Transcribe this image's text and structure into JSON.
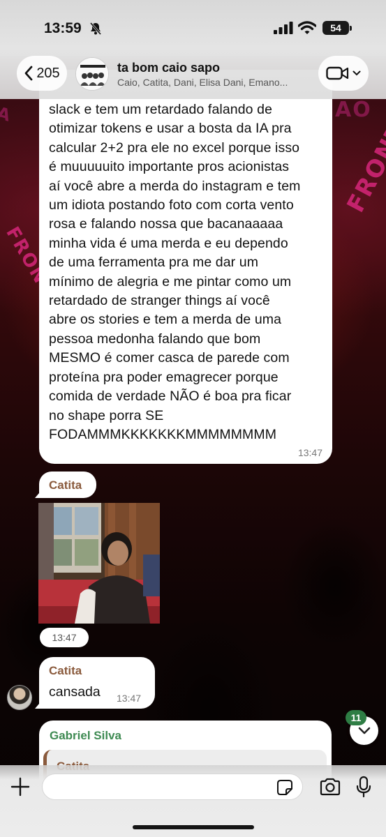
{
  "status_bar": {
    "time": "13:59",
    "battery": "54"
  },
  "header": {
    "back_count": "205",
    "title": "ta bom caio sapo",
    "members": "Caio, Catita, Dani, Elisa Dani, Emano..."
  },
  "messages": {
    "long": {
      "text": "slack e tem um retardado falando de\notimizar tokens e usar a bosta da IA pra\ncalcular 2+2 pra ele no excel porque isso\né muuuuuito importante pros acionistas\naí você abre a merda do instagram e tem\num idiota postando foto com corta vento\nrosa e falando nossa que bacanaaaaa\nminha vida é uma merda e eu dependo\nde uma ferramenta pra me dar um\nmínimo de alegria e me pintar como um\nretardado de stranger things aí você\nabre os stories e tem a merda de uma\npessoa medonha falando que bom\nMESMO é comer casca de parede com\nproteína pra poder emagrecer porque\ncomida de verdade NÃO é boa pra ficar\nno shape porra SE\nFODAMMMKKKKKKKMMMMMMMM",
      "time": "13:47"
    },
    "photo_sender": "Catita",
    "photo_time": "13:47",
    "cansada": {
      "sender": "Catita",
      "text": "cansada",
      "time": "13:47"
    },
    "quoted": {
      "sender": "Gabriel Silva",
      "quote_sender": "Catita"
    }
  },
  "scroll": {
    "unread_count": "11"
  },
  "composer": {
    "placeholder": ""
  },
  "colors": {
    "catita_name": "#8a5a3c",
    "gabriel_name": "#3e8a52",
    "badge": "#2e7d44"
  },
  "icons": [
    "bell-off-icon",
    "signal-icon",
    "wifi-icon",
    "chevron-left-icon",
    "video-camera-icon",
    "chevron-down-icon",
    "plus-icon",
    "sticker-icon",
    "camera-icon",
    "microphone-icon"
  ]
}
